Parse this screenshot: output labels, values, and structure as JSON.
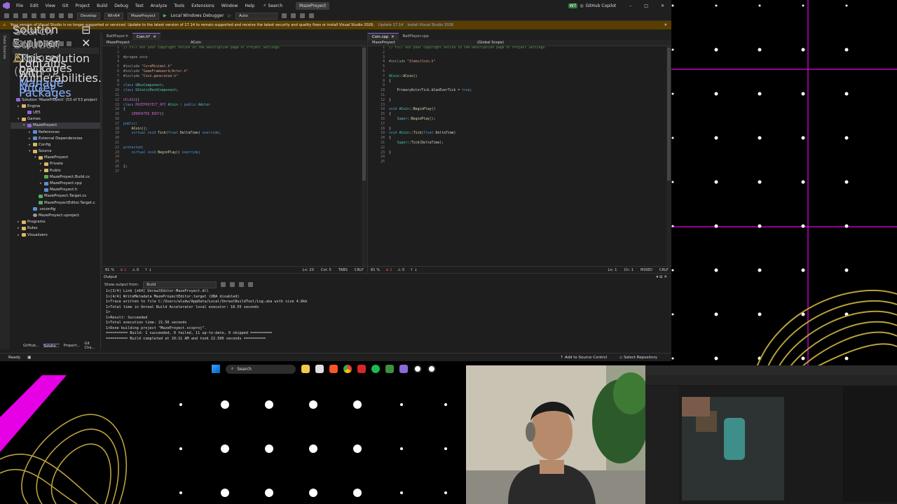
{
  "menu": {
    "items": [
      "File",
      "Edit",
      "View",
      "Git",
      "Project",
      "Build",
      "Debug",
      "Test",
      "Analyze",
      "Tools",
      "Extensions",
      "Window",
      "Help"
    ],
    "search_label": "Search",
    "project_title": "MazeProyect",
    "copilot_label": "GitHub Copilot",
    "avatar": "WT"
  },
  "toolbar": {
    "config": "Develop",
    "platform": "Win64",
    "startup": "MazeProyect",
    "debugger": "Local Windows Debugger",
    "mode": "Auto"
  },
  "infobar": {
    "message": "Your version of Visual Studio is no longer supported or serviced. Update to the latest version of 17.14 to remain supported and receive the latest security and quality fixes or install Visual Studio 2026.",
    "link1": "Update 17.14",
    "link2": "Install Visual Studio 2026"
  },
  "solution_explorer": {
    "title": "Solution Explorer",
    "search_placeholder": "Search Solution Explorer (Ctrl+;)",
    "warning_text": "This solution contains packages with vulnerabilities.",
    "warning_link": "Manage NuGet Packages",
    "side_tabs": [
      "Data Sources"
    ],
    "tree": [
      {
        "label": "Solution 'MazeProyect' (53 of 53 project",
        "indent": 0,
        "icon": "proj",
        "fold": ""
      },
      {
        "label": "Engine",
        "indent": 1,
        "icon": "folder",
        "fold": "▸"
      },
      {
        "label": "UE5",
        "indent": 2,
        "icon": "proj",
        "fold": ""
      },
      {
        "label": "Games",
        "indent": 1,
        "icon": "folder",
        "fold": "▾"
      },
      {
        "label": "MazeProyect",
        "indent": 2,
        "icon": "proj",
        "fold": "▾",
        "selected": true
      },
      {
        "label": "References",
        "indent": 3,
        "icon": "file",
        "fold": "▸"
      },
      {
        "label": "External Dependencies",
        "indent": 3,
        "icon": "file",
        "fold": "▸"
      },
      {
        "label": "Config",
        "indent": 3,
        "icon": "folder",
        "fold": "▸"
      },
      {
        "label": "Source",
        "indent": 3,
        "icon": "folder",
        "fold": "▾"
      },
      {
        "label": "MazeProyect",
        "indent": 4,
        "icon": "folder",
        "fold": "▾"
      },
      {
        "label": "Private",
        "indent": 5,
        "icon": "folder",
        "fold": "▸"
      },
      {
        "label": "Public",
        "indent": 5,
        "icon": "folder",
        "fold": "▸"
      },
      {
        "label": "MazeProyect.Build.cs",
        "indent": 5,
        "icon": "cs",
        "fold": ""
      },
      {
        "label": "MazeProyect.cpp",
        "indent": 5,
        "icon": "file",
        "fold": "▸"
      },
      {
        "label": "MazeProyect.h",
        "indent": 5,
        "icon": "file",
        "fold": ""
      },
      {
        "label": "MazeProyect.Target.cs",
        "indent": 4,
        "icon": "cs",
        "fold": ""
      },
      {
        "label": "MazeProyectEditor.Target.c",
        "indent": 4,
        "icon": "cs",
        "fold": ""
      },
      {
        "label": ".vsconfig",
        "indent": 3,
        "icon": "file",
        "fold": ""
      },
      {
        "label": "MazeProyect.uproject",
        "indent": 3,
        "icon": "gear",
        "fold": ""
      },
      {
        "label": "Programs",
        "indent": 1,
        "icon": "folder",
        "fold": "▸"
      },
      {
        "label": "Rules",
        "indent": 1,
        "icon": "folder",
        "fold": "▸"
      },
      {
        "label": "Visualizers",
        "indent": 1,
        "icon": "folder",
        "fold": "▸"
      }
    ],
    "bottom_tabs": [
      "GitHub...",
      "Solutio...",
      "Propert...",
      "Git Cha..."
    ]
  },
  "editor_left": {
    "tabs": [
      "BallPlayer.h",
      "Coin.h*"
    ],
    "active_tab": 1,
    "nav_project": "MazeProyect",
    "nav_scope": "ACoin",
    "zoom": "81 %",
    "errors": "1",
    "warnings": "0",
    "position": "Ln: 20",
    "column": "Col: 5",
    "tabs_mode": "TABS",
    "eol": "CRLF",
    "lines": [
      {
        "n": "1",
        "html": "<span class='cm'>// Fill out your copyright notice in the Description page of Project Settings.</span>"
      },
      {
        "n": "2",
        "html": ""
      },
      {
        "n": "3",
        "html": "<span class='pp'>#pragma once</span>"
      },
      {
        "n": "4",
        "html": ""
      },
      {
        "n": "5",
        "html": "<span class='pp'>#include</span> <span class='st'>\"CoreMinimal.h\"</span>"
      },
      {
        "n": "6",
        "html": "<span class='pp'>#include</span> <span class='st'>\"GameFramework/Actor.h\"</span>"
      },
      {
        "n": "7",
        "html": "<span class='pp'>#include</span> <span class='st'>\"Coin.generated.h\"</span>"
      },
      {
        "n": "8",
        "html": ""
      },
      {
        "n": "9",
        "html": "<span class='kw'>class</span> <span class='ty'>UBoxComponent</span>;"
      },
      {
        "n": "10",
        "html": "<span class='kw'>class</span> <span class='ty'>UStaticMeshComponent</span>;"
      },
      {
        "n": "11",
        "html": ""
      },
      {
        "n": "12",
        "html": "<span class='mc'>UCLASS</span>()"
      },
      {
        "n": "13",
        "html": "<span class='kw'>class</span> <span class='mc'>MAZEPROYECT_API</span> <span class='ty'>ACoin</span> : <span class='kw'>public</span> <span class='ty'>AActor</span>"
      },
      {
        "n": "14",
        "html": "{"
      },
      {
        "n": "15",
        "html": "    <span class='mc'>GENERATED_BODY</span>()"
      },
      {
        "n": "16",
        "html": ""
      },
      {
        "n": "17",
        "html": "<span class='kw'>public</span>:"
      },
      {
        "n": "18",
        "html": "    <span class='fn'>ACoin</span>();"
      },
      {
        "n": "19",
        "html": "    <span class='kw'>virtual</span> <span class='kw'>void</span> <span class='fn'>Tick</span>(<span class='kw'>float</span> DeltaTime) <span class='kw'>override</span>;"
      },
      {
        "n": "20",
        "html": ""
      },
      {
        "n": "21",
        "html": ""
      },
      {
        "n": "22",
        "html": "<span class='kw'>protected</span>:"
      },
      {
        "n": "23",
        "html": "    <span class='kw'>virtual</span> <span class='kw'>void</span> <span class='fn'>BeginPlay</span>() <span class='kw'>override</span>;"
      },
      {
        "n": "24",
        "html": ""
      },
      {
        "n": "25",
        "html": ""
      },
      {
        "n": "26",
        "html": "};"
      },
      {
        "n": "27",
        "html": ""
      }
    ]
  },
  "editor_right": {
    "tabs": [
      "Coin.cpp",
      "BallPlayer.cpp"
    ],
    "active_tab": 0,
    "nav_project": "MazeProyect",
    "nav_scope": "(Global Scope)",
    "zoom": "81 %",
    "errors": "2",
    "warnings": "0",
    "position": "Ln: 1",
    "column": "Ch: 1",
    "tabs_mode": "MIXED",
    "eol": "CRLF",
    "lines": [
      {
        "n": "1",
        "html": "<span class='cm'>// Fill out your copyright notice in the Description page of Project Settings.</span>"
      },
      {
        "n": "2",
        "html": ""
      },
      {
        "n": "3",
        "html": ""
      },
      {
        "n": "4",
        "html": "<span class='pp'>#include</span> <span class='st'>\"Items/Coin.h\"</span>"
      },
      {
        "n": "5",
        "html": ""
      },
      {
        "n": "6",
        "html": ""
      },
      {
        "n": "7",
        "html": "<span class='ty'>ACoin</span>::<span class='fn'>ACoin</span>()"
      },
      {
        "n": "8",
        "html": "{"
      },
      {
        "n": "9",
        "html": ""
      },
      {
        "n": "10",
        "html": "    PrimaryActorTick.bCanEverTick = <span class='kw'>true</span>;"
      },
      {
        "n": "11",
        "html": ""
      },
      {
        "n": "12",
        "html": "}"
      },
      {
        "n": "13",
        "html": ""
      },
      {
        "n": "14",
        "html": "<span class='kw'>void</span> <span class='ty'>ACoin</span>::<span class='fn'>BeginPlay</span>()"
      },
      {
        "n": "15",
        "html": "{"
      },
      {
        "n": "16",
        "html": "    <span class='ty'>Super</span>::<span class='fn'>BeginPlay</span>();"
      },
      {
        "n": "17",
        "html": ""
      },
      {
        "n": "18",
        "html": "}"
      },
      {
        "n": "19",
        "html": "<span class='kw'>void</span> <span class='ty'>ACoin</span>::<span class='fn'>Tick</span>(<span class='kw'>float</span> DeltaTime)"
      },
      {
        "n": "20",
        "html": "{"
      },
      {
        "n": "21",
        "html": "    <span class='ty'>Super</span>::<span class='fn'>Tick</span>(DeltaTime);"
      },
      {
        "n": "22",
        "html": ""
      },
      {
        "n": "23",
        "html": "}"
      },
      {
        "n": "24",
        "html": ""
      },
      {
        "n": "25",
        "html": ""
      }
    ]
  },
  "output": {
    "title": "Output",
    "show_from_label": "Show output from:",
    "show_from_value": "Build",
    "lines": [
      "1>[3/4] Link [x64] UnrealEditor-MazeProyect.dll",
      "1>[4/4] WriteMetadata MazeProyectEditor.target (UBA disabled)",
      "1>Trace written to file C:/Users/wludw/AppData/Local/UnrealBuildTool/Log.uba with size 4.8kb",
      "1>Total time in Unreal Build Accelerator local executor: 18.55 seconds",
      "1>",
      "1>Result: Succeeded",
      "1>Total execution time: 21.56 seconds",
      "1>Done building project \"MazeProyect.vcxproj\".",
      "========== Build: 1 succeeded, 0 failed, 11 up-to-date, 0 skipped ==========",
      "========== Build completed at 10:11 AM and took 22.506 seconds =========="
    ]
  },
  "statusbar": {
    "ready": "Ready",
    "source_control": "Add to Source Control",
    "repository": "Select Repository"
  },
  "taskbar": {
    "search": "Search"
  },
  "colors": {
    "accent": "#8a6ad6",
    "magenta": "#e600e6",
    "gold": "#b8a23a"
  }
}
